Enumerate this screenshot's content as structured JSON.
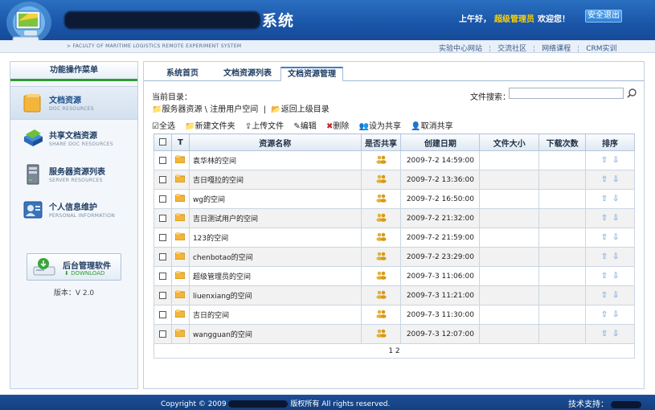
{
  "header": {
    "title_suffix": "系统",
    "faculty_line": "> FACULTY OF MARITIME LOGISTICS REMOTE EXPERIMENT SYSTEM",
    "greeting": "上午好，",
    "username": "超级管理员",
    "welcome": "欢迎您！",
    "logout": "安全退出"
  },
  "toplinks": [
    "实验中心网站",
    "交流社区",
    "网络课程",
    "CRM实训"
  ],
  "sidebar": {
    "title": "功能操作菜单",
    "items": [
      {
        "label": "文档资源",
        "sub": "DOC RESOURCES",
        "icon": "folder-icon"
      },
      {
        "label": "共享文档资源",
        "sub": "SHARE DOC RESOURCES",
        "icon": "books-icon"
      },
      {
        "label": "服务器资源列表",
        "sub": "SERVER RESOURCES",
        "icon": "server-icon"
      },
      {
        "label": "个人信息维护",
        "sub": "PERSONAL INFORMATION",
        "icon": "personal-info-icon"
      }
    ],
    "download": {
      "label": "后台管理软件",
      "sub": "DOWNLOAD"
    },
    "version": "版本：V 2.0"
  },
  "tabs": [
    "系统首页",
    "文档资源列表",
    "文档资源管理"
  ],
  "current_dir_label": "当前目录：",
  "path": {
    "folder": "服务器资源",
    "separator": "\\",
    "current": "注册用户空间",
    "pipe": "|",
    "up": "返回上级目录"
  },
  "search": {
    "label": "文件搜索：",
    "value": ""
  },
  "toolbar": {
    "select_all": "全选",
    "new_folder": "新建文件夹",
    "upload": "上传文件",
    "edit": "编辑",
    "delete": "删除",
    "set_share": "设为共享",
    "cancel_share": "取消共享"
  },
  "table": {
    "headers": {
      "type": "T",
      "name": "资源名称",
      "shared": "是否共享",
      "date": "创建日期",
      "size": "文件大小",
      "downloads": "下载次数",
      "sort": "排序"
    },
    "rows": [
      {
        "name": "袁华林的空间",
        "date": "2009-7-2 14:59:00"
      },
      {
        "name": "吉日嘎拉的空间",
        "date": "2009-7-2 13:36:00"
      },
      {
        "name": "wg的空间",
        "date": "2009-7-2 16:50:00"
      },
      {
        "name": "吉日测试用户的空间",
        "date": "2009-7-2 21:32:00"
      },
      {
        "name": "123的空间",
        "date": "2009-7-2 21:59:00"
      },
      {
        "name": "chenbotao的空间",
        "date": "2009-7-2 23:29:00"
      },
      {
        "name": "超级管理员的空间",
        "date": "2009-7-3 11:06:00"
      },
      {
        "name": "liuenxiang的空间",
        "date": "2009-7-3 11:21:00"
      },
      {
        "name": "吉日的空间",
        "date": "2009-7-3 11:30:00"
      },
      {
        "name": "wangguan的空间",
        "date": "2009-7-3 12:07:00"
      }
    ],
    "pager": "1 2"
  },
  "footer": {
    "copyright": "Copyright © 2009",
    "rights": "版权所有  All rights reserved.",
    "tech": "技术支持："
  }
}
